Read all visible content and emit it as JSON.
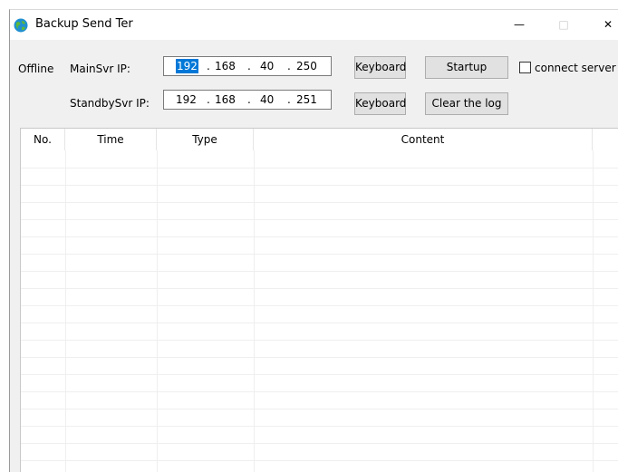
{
  "window": {
    "title": "Backup Send Ter",
    "controls": {
      "minimize": "—",
      "maximize": "□",
      "close": "✕"
    }
  },
  "status": {
    "text": "Offline"
  },
  "main_server": {
    "label": "MainSvr IP:",
    "octets": [
      "192",
      "168",
      "40",
      "250"
    ],
    "keyboard_label": "Keyboard",
    "startup_label": "Startup"
  },
  "standby_server": {
    "label": "StandbySvr IP:",
    "octets": [
      "192",
      "168",
      "40",
      "251"
    ],
    "keyboard_label": "Keyboard",
    "clear_label": "Clear the log"
  },
  "connect": {
    "label": "connect server",
    "checked": false
  },
  "log_table": {
    "columns": [
      "No.",
      "Time",
      "Type",
      "Content"
    ],
    "rows": []
  },
  "colors": {
    "selection": "#0078d7",
    "button_face": "#e1e1e1",
    "window_bg": "#f0f0f0"
  },
  "icons": [
    "globe-icon",
    "minimize-icon",
    "maximize-icon",
    "close-icon",
    "checkbox-icon"
  ]
}
